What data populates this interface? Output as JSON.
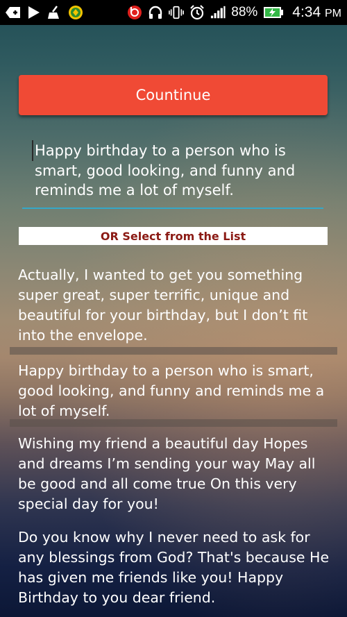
{
  "status_bar": {
    "battery_percent": "88%",
    "time": "4:34",
    "time_suffix": "PM",
    "icons": [
      "add-icon",
      "play-icon",
      "cleaner-icon",
      "app-icon",
      "beats-icon",
      "headset-icon",
      "vibrate-icon",
      "alarm-icon",
      "signal-icon",
      "battery-icon"
    ]
  },
  "continue_button": {
    "label": "Countinue"
  },
  "message_field": {
    "value": "Happy birthday to a person who is smart, good looking, and funny and reminds me a lot of myself."
  },
  "or_select": {
    "label": "OR Select from the List"
  },
  "list": {
    "items": [
      "Actually, I wanted to get you something super great, super terrific, unique and beautiful for your birthday, but I don’t fit into the envelope.",
      "Happy birthday to a person who is smart, good looking, and funny and reminds me a lot of myself.",
      "Wishing my friend a beautiful day Hopes and dreams I’m sending your way May all be good and all come true On this very special day for you!",
      "Do you know why I never need to ask for any blessings from God? That's because He has given me friends like you! Happy Birthday to you dear friend."
    ]
  },
  "colors": {
    "accent_button": "#f04a35",
    "field_underline": "#34a8c9",
    "or_text": "#8b1a14"
  }
}
